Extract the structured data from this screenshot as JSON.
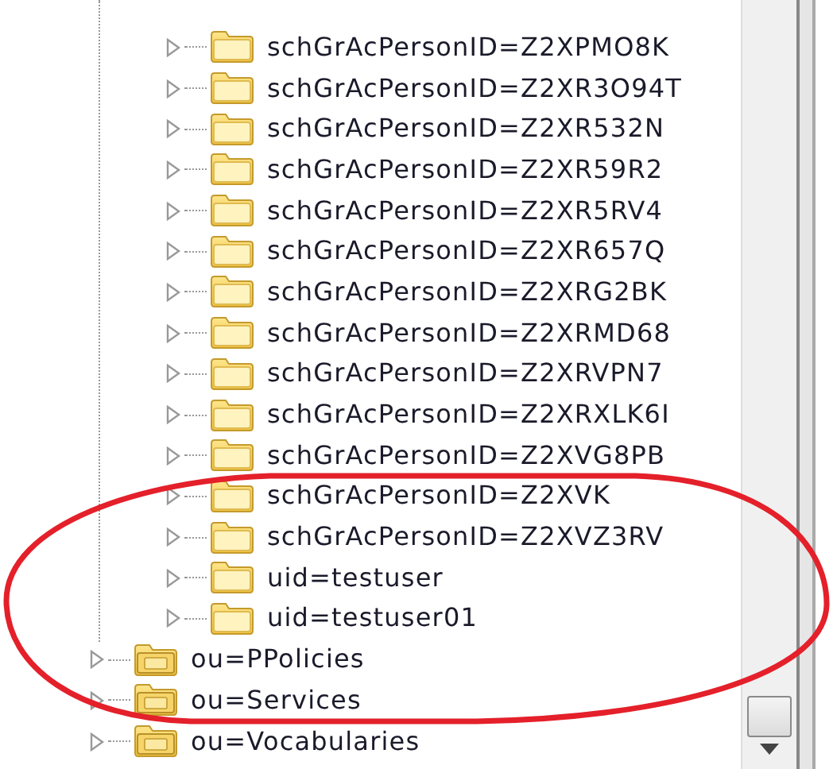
{
  "tree": [
    {
      "expanded": true,
      "children": [
        {
          "label": "schGrAcPersonID=Z2XPMO8K",
          "expanded": false
        },
        {
          "label": "schGrAcPersonID=Z2XR3O94T",
          "expanded": false
        },
        {
          "label": "schGrAcPersonID=Z2XR532N",
          "expanded": false
        },
        {
          "label": "schGrAcPersonID=Z2XR59R2",
          "expanded": false
        },
        {
          "label": "schGrAcPersonID=Z2XR5RV4",
          "expanded": false
        },
        {
          "label": "schGrAcPersonID=Z2XR657Q",
          "expanded": false
        },
        {
          "label": "schGrAcPersonID=Z2XRG2BK",
          "expanded": false
        },
        {
          "label": "schGrAcPersonID=Z2XRMD68",
          "expanded": false
        },
        {
          "label": "schGrAcPersonID=Z2XRVPN7",
          "expanded": false
        },
        {
          "label": "schGrAcPersonID=Z2XRXLK6I",
          "expanded": false
        },
        {
          "label": "schGrAcPersonID=Z2XVG8PB",
          "expanded": false
        },
        {
          "label": "schGrAcPersonID=Z2XVK",
          "expanded": false
        },
        {
          "label": "schGrAcPersonID=Z2XVZ3RV",
          "expanded": false
        },
        {
          "label": "uid=testuser",
          "expanded": false
        },
        {
          "label": "uid=testuser01",
          "expanded": false
        }
      ]
    },
    {
      "label": "ou=PPolicies",
      "expanded": false
    },
    {
      "label": "ou=Services",
      "expanded": false
    },
    {
      "label": "ou=Vocabularies",
      "expanded": false
    }
  ]
}
